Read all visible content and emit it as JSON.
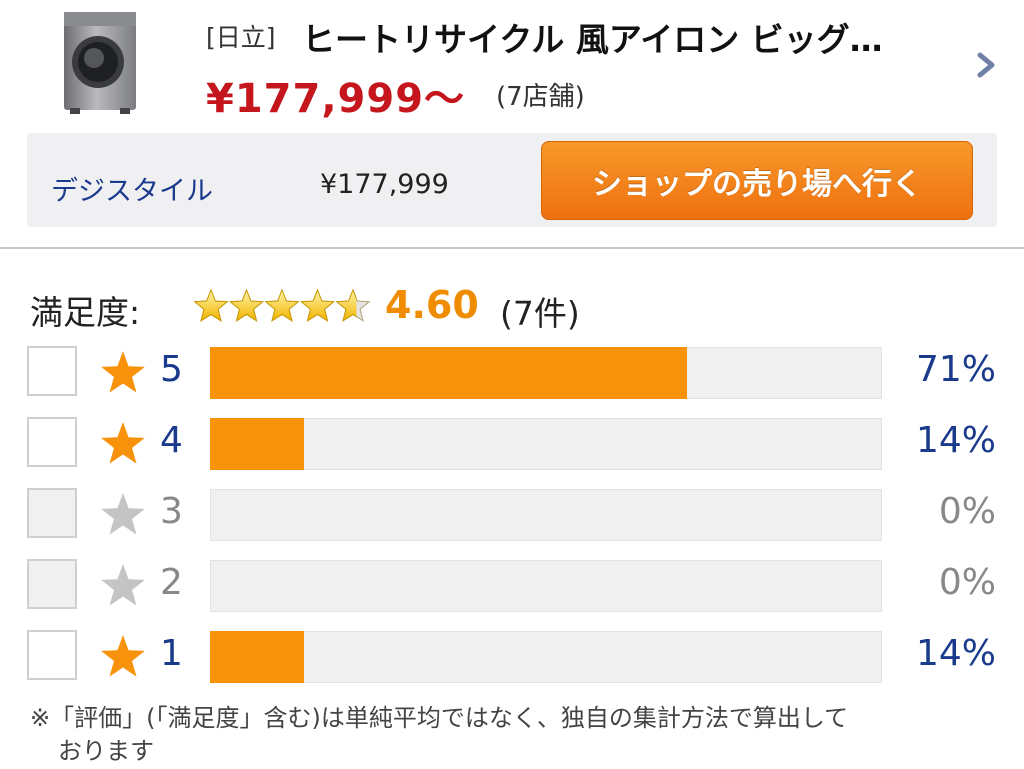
{
  "product": {
    "maker": "[日立]",
    "name": "ヒートリサイクル 風アイロン ビッグ…",
    "price": "¥177,999〜",
    "stores": "(7店舗)"
  },
  "shop": {
    "name": "デジスタイル",
    "price": "¥177,999",
    "button_label": "ショップの売り場へ行く"
  },
  "rating": {
    "label": "満足度:",
    "score": "4.60",
    "count": "(7件)",
    "star_fraction": 0.92,
    "rows": [
      {
        "stars": "5",
        "percent_text": "71%",
        "percent": 71,
        "active": true
      },
      {
        "stars": "4",
        "percent_text": "14%",
        "percent": 14,
        "active": true
      },
      {
        "stars": "3",
        "percent_text": "0%",
        "percent": 0,
        "active": false
      },
      {
        "stars": "2",
        "percent_text": "0%",
        "percent": 0,
        "active": false
      },
      {
        "stars": "1",
        "percent_text": "14%",
        "percent": 14,
        "active": true
      }
    ]
  },
  "note": {
    "line1": "※「評価」(「満足度」含む)は単純平均ではなく、独自の集計方法で算出して",
    "line2": "おります"
  },
  "colors": {
    "accent_orange": "#f8920a",
    "price_red": "#c4161c",
    "link_blue": "#1a3a8c",
    "star_gray": "#c4c4c4"
  },
  "icons": {
    "product": "washing-machine-icon",
    "chevron": "chevron-right-icon",
    "star": "star-icon"
  }
}
